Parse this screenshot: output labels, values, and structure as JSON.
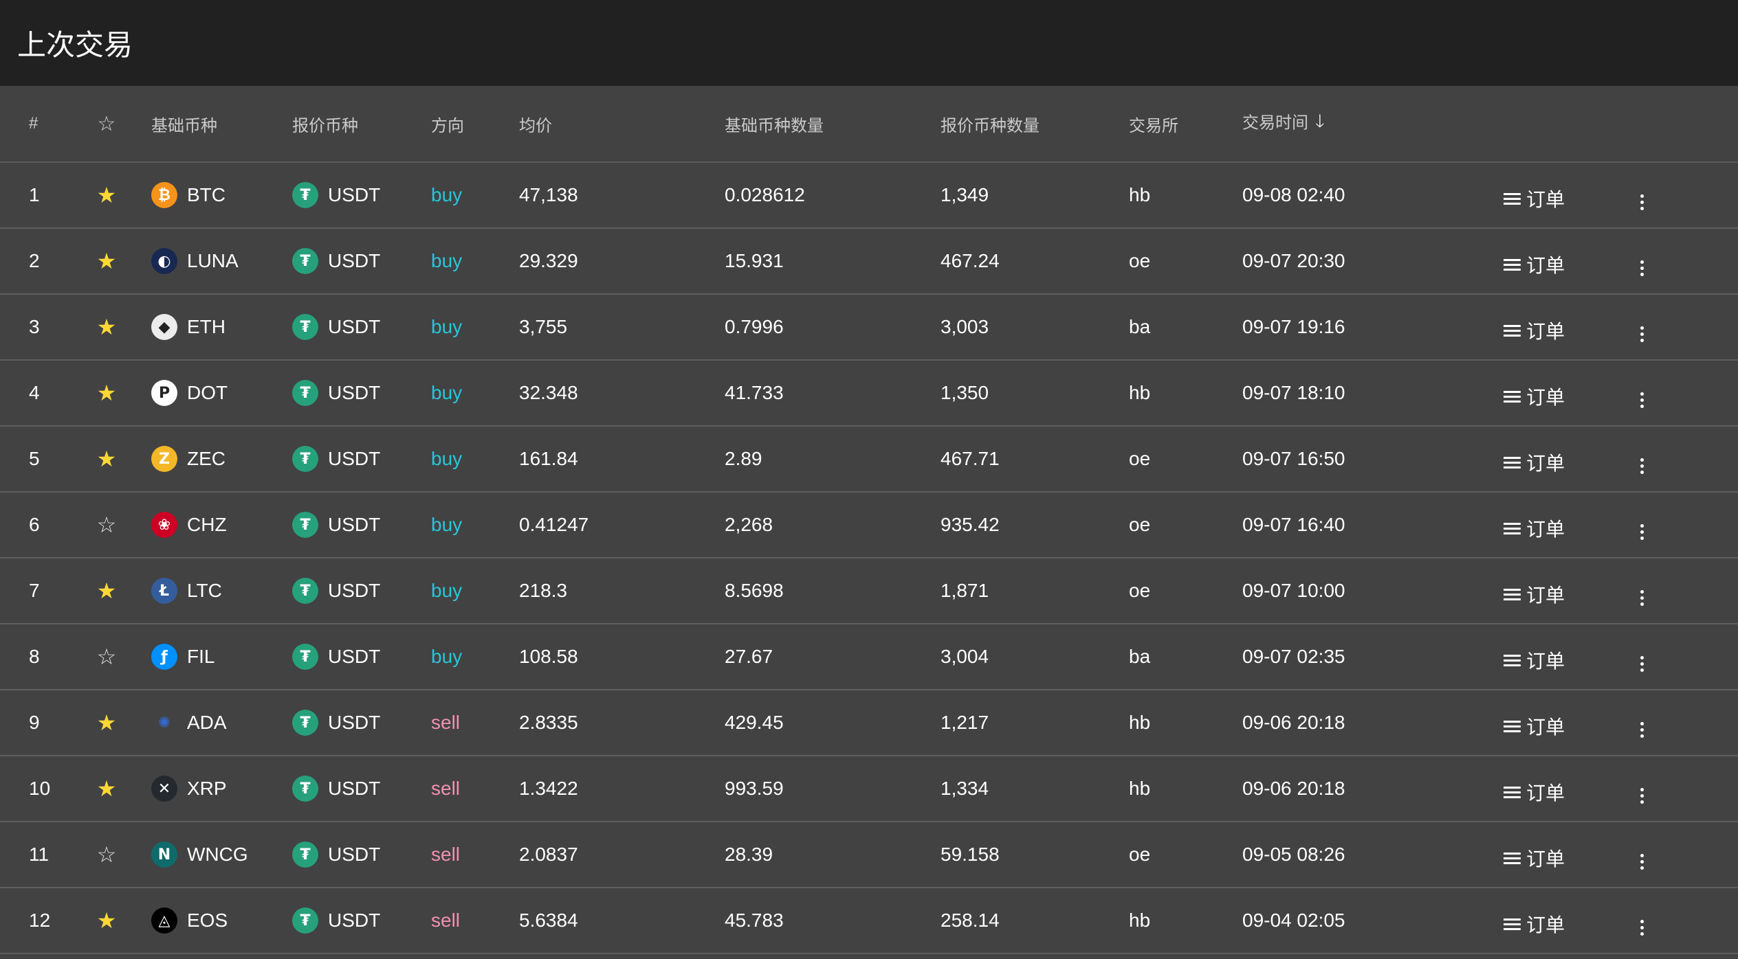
{
  "header": {
    "title": "上次交易"
  },
  "columns": {
    "index": "#",
    "base": "基础币种",
    "quote": "报价币种",
    "side": "方向",
    "avg_price": "均价",
    "base_amount": "基础币种数量",
    "quote_amount": "报价币种数量",
    "exchange": "交易所",
    "time": "交易时间"
  },
  "action_label": "订单",
  "rows": [
    {
      "idx": "1",
      "fav": true,
      "base": "BTC",
      "base_icon": "bitcoin-icon",
      "base_color": "#f7931a",
      "base_glyph": "₿",
      "quote": "USDT",
      "side": "buy",
      "price": "47,138",
      "base_amt": "0.028612",
      "quote_amt": "1,349",
      "exchange": "hb",
      "time": "09-08 02:40"
    },
    {
      "idx": "2",
      "fav": true,
      "base": "LUNA",
      "base_icon": "terra-luna-icon",
      "base_color": "#172852",
      "base_glyph": "◐",
      "quote": "USDT",
      "side": "buy",
      "price": "29.329",
      "base_amt": "15.931",
      "quote_amt": "467.24",
      "exchange": "oe",
      "time": "09-07 20:30"
    },
    {
      "idx": "3",
      "fav": true,
      "base": "ETH",
      "base_icon": "ethereum-icon",
      "base_color": "#ececec",
      "base_glyph": "◆",
      "quote": "USDT",
      "side": "buy",
      "price": "3,755",
      "base_amt": "0.7996",
      "quote_amt": "3,003",
      "exchange": "ba",
      "time": "09-07 19:16"
    },
    {
      "idx": "4",
      "fav": true,
      "base": "DOT",
      "base_icon": "polkadot-icon",
      "base_color": "#ffffff",
      "base_glyph": "P",
      "quote": "USDT",
      "side": "buy",
      "price": "32.348",
      "base_amt": "41.733",
      "quote_amt": "1,350",
      "exchange": "hb",
      "time": "09-07 18:10"
    },
    {
      "idx": "5",
      "fav": true,
      "base": "ZEC",
      "base_icon": "zcash-icon",
      "base_color": "#f4b728",
      "base_glyph": "Z",
      "quote": "USDT",
      "side": "buy",
      "price": "161.84",
      "base_amt": "2.89",
      "quote_amt": "467.71",
      "exchange": "oe",
      "time": "09-07 16:50"
    },
    {
      "idx": "6",
      "fav": false,
      "base": "CHZ",
      "base_icon": "chiliz-icon",
      "base_color": "#cd0124",
      "base_glyph": "❀",
      "quote": "USDT",
      "side": "buy",
      "price": "0.41247",
      "base_amt": "2,268",
      "quote_amt": "935.42",
      "exchange": "oe",
      "time": "09-07 16:40"
    },
    {
      "idx": "7",
      "fav": true,
      "base": "LTC",
      "base_icon": "litecoin-icon",
      "base_color": "#345d9d",
      "base_glyph": "Ł",
      "quote": "USDT",
      "side": "buy",
      "price": "218.3",
      "base_amt": "8.5698",
      "quote_amt": "1,871",
      "exchange": "oe",
      "time": "09-07 10:00"
    },
    {
      "idx": "8",
      "fav": false,
      "base": "FIL",
      "base_icon": "filecoin-icon",
      "base_color": "#0090ff",
      "base_glyph": "ƒ",
      "quote": "USDT",
      "side": "buy",
      "price": "108.58",
      "base_amt": "27.67",
      "quote_amt": "3,004",
      "exchange": "ba",
      "time": "09-07 02:35"
    },
    {
      "idx": "9",
      "fav": true,
      "base": "ADA",
      "base_icon": "cardano-icon",
      "base_color": "#424242",
      "base_glyph": "✺",
      "quote": "USDT",
      "side": "sell",
      "price": "2.8335",
      "base_amt": "429.45",
      "quote_amt": "1,217",
      "exchange": "hb",
      "time": "09-06 20:18"
    },
    {
      "idx": "10",
      "fav": true,
      "base": "XRP",
      "base_icon": "ripple-icon",
      "base_color": "#23292f",
      "base_glyph": "✕",
      "quote": "USDT",
      "side": "sell",
      "price": "1.3422",
      "base_amt": "993.59",
      "quote_amt": "1,334",
      "exchange": "hb",
      "time": "09-06 20:18"
    },
    {
      "idx": "11",
      "fav": false,
      "base": "WNCG",
      "base_icon": "wncg-icon",
      "base_color": "#0f6b6b",
      "base_glyph": "N",
      "quote": "USDT",
      "side": "sell",
      "price": "2.0837",
      "base_amt": "28.39",
      "quote_amt": "59.158",
      "exchange": "oe",
      "time": "09-05 08:26"
    },
    {
      "idx": "12",
      "fav": true,
      "base": "EOS",
      "base_icon": "eos-icon",
      "base_color": "#000000",
      "base_glyph": "◬",
      "quote": "USDT",
      "side": "sell",
      "price": "5.6384",
      "base_amt": "45.783",
      "quote_amt": "258.14",
      "exchange": "hb",
      "time": "09-04 02:05"
    }
  ],
  "colors": {
    "buy": "#26c6da",
    "sell": "#f48fb1",
    "star": "#fdd835",
    "usdt": "#26a17b"
  }
}
